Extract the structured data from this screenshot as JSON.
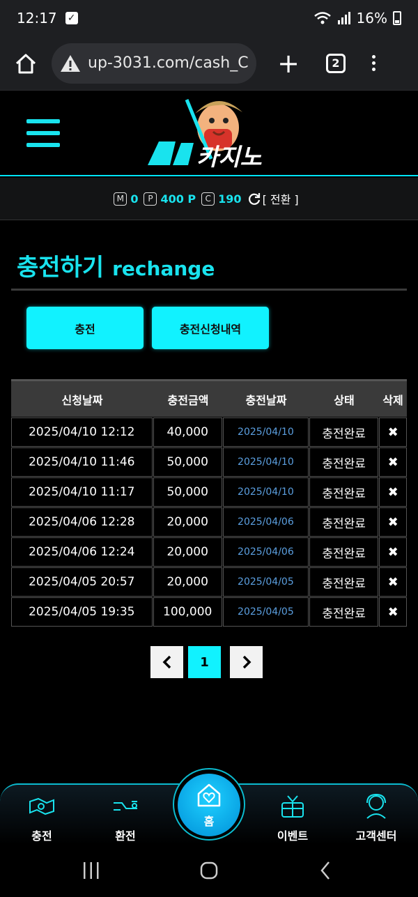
{
  "status_bar": {
    "time": "12:17",
    "battery": "16%"
  },
  "browser": {
    "url": "up-3031.com/cash_C",
    "tab_count": "2"
  },
  "balance": {
    "m_badge": "M",
    "m_value": "0",
    "p_badge": "P",
    "p_value": "400 P",
    "c_badge": "C",
    "c_value": "190",
    "convert_label": "[ 전환 ]"
  },
  "page": {
    "title_ko": "충전하기",
    "title_en": "rechange"
  },
  "tabs": {
    "recharge": "충전",
    "history": "충전신청내역"
  },
  "table": {
    "headers": [
      "신청날짜",
      "충전금액",
      "충전날짜",
      "상태",
      "삭제"
    ],
    "rows": [
      [
        "2025/04/10 12:12",
        "40,000",
        "2025/04/10",
        "충전완료"
      ],
      [
        "2025/04/10 11:46",
        "50,000",
        "2025/04/10",
        "충전완료"
      ],
      [
        "2025/04/10 11:17",
        "50,000",
        "2025/04/10",
        "충전완료"
      ],
      [
        "2025/04/06 12:28",
        "20,000",
        "2025/04/06",
        "충전완료"
      ],
      [
        "2025/04/06 12:24",
        "20,000",
        "2025/04/06",
        "충전완료"
      ],
      [
        "2025/04/05 20:57",
        "20,000",
        "2025/04/05",
        "충전완료"
      ],
      [
        "2025/04/05 19:35",
        "100,000",
        "2025/04/05",
        "충전완료"
      ]
    ],
    "delete_glyph": "✖"
  },
  "pagination": {
    "prev": "<",
    "current": "1",
    "next": ">"
  },
  "bottom_nav": {
    "recharge": "충전",
    "exchange": "환전",
    "home": "홈",
    "event": "이벤트",
    "support": "고객센터"
  },
  "colors": {
    "accent": "#19e3ee",
    "link": "#5b9fe0",
    "background": "#000000"
  }
}
